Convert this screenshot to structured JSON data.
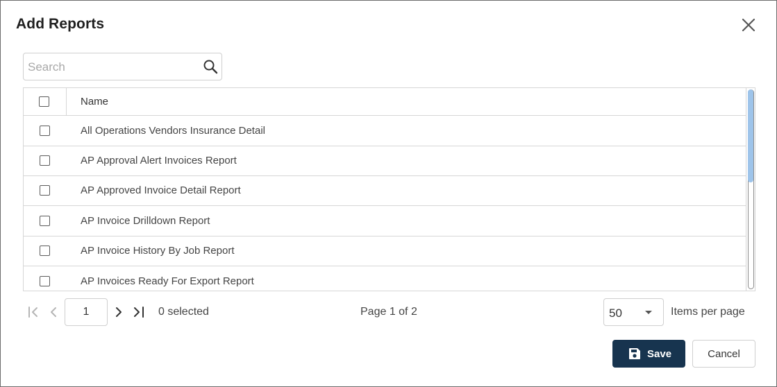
{
  "dialog": {
    "title": "Add Reports"
  },
  "search": {
    "placeholder": "Search",
    "value": ""
  },
  "grid": {
    "columns": [
      "Name"
    ],
    "rows": [
      {
        "name": "All Operations Vendors Insurance Detail",
        "checked": false
      },
      {
        "name": "AP Approval Alert Invoices Report",
        "checked": false
      },
      {
        "name": "AP Approved Invoice Detail Report",
        "checked": false
      },
      {
        "name": "AP Invoice Drilldown Report",
        "checked": false
      },
      {
        "name": "AP Invoice History By Job Report",
        "checked": false
      },
      {
        "name": "AP Invoices Ready For Export Report",
        "checked": false
      }
    ]
  },
  "pager": {
    "current_page": "1",
    "selected_text": "0 selected",
    "page_info": "Page 1 of 2",
    "page_size": "50",
    "items_per_page_label": "Items per page"
  },
  "footer": {
    "save_label": "Save",
    "cancel_label": "Cancel"
  },
  "colors": {
    "primary": "#17344f",
    "scroll_thumb": "#9ec4ea",
    "border": "#d6d6d6"
  }
}
